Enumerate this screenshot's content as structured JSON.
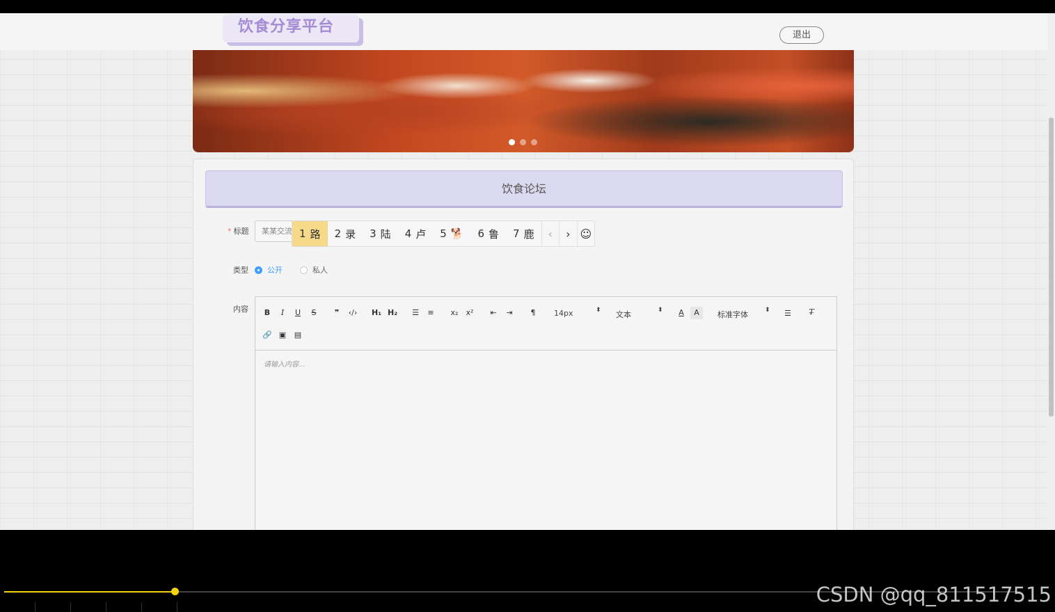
{
  "header": {
    "logo_text": "饮食分享平台",
    "logout_label": "退出"
  },
  "banner": {
    "slide_count": 3,
    "active_index": 0
  },
  "forum": {
    "heading": "饮食论坛",
    "title_field": {
      "required_marker": "*",
      "label": "标题",
      "value": "某某交流lu"
    },
    "type_field": {
      "label": "类型",
      "options": [
        "公开",
        "私人"
      ],
      "selected": "公开"
    },
    "content_field": {
      "label": "内容",
      "placeholder": "请输入内容..."
    }
  },
  "editor_toolbar": {
    "row1": [
      "bold-icon",
      "italic-icon",
      "underline-icon",
      "strike-icon",
      "blockquote-icon",
      "code-block-icon",
      "h1-icon",
      "h2-icon",
      "ordered-list-icon",
      "bullet-list-icon",
      "subscript-icon",
      "superscript-icon",
      "outdent-icon",
      "indent-icon",
      "rtl-icon"
    ],
    "font_size": "14px",
    "header_type": "文本",
    "font_family": "标准字体",
    "row2": [
      "link-icon",
      "image-icon",
      "video-icon"
    ]
  },
  "ime": {
    "candidates": [
      {
        "num": "1",
        "text": "路"
      },
      {
        "num": "2",
        "text": "录"
      },
      {
        "num": "3",
        "text": "陆"
      },
      {
        "num": "4",
        "text": "卢"
      },
      {
        "num": "5",
        "text": "🐕"
      },
      {
        "num": "6",
        "text": "鲁"
      },
      {
        "num": "7",
        "text": "鹿"
      }
    ],
    "active_candidate": 0,
    "prev_icon": "‹",
    "next_icon": "›",
    "emoji_icon": "☺"
  },
  "player": {
    "progress_fraction": 0.168,
    "watermark": "CSDN @qq_811517515"
  },
  "colors": {
    "accent_purple": "#a48bd3",
    "radio_blue": "#409eff",
    "ime_highlight": "#f7d98a",
    "progress_yellow": "#f2d20b"
  }
}
